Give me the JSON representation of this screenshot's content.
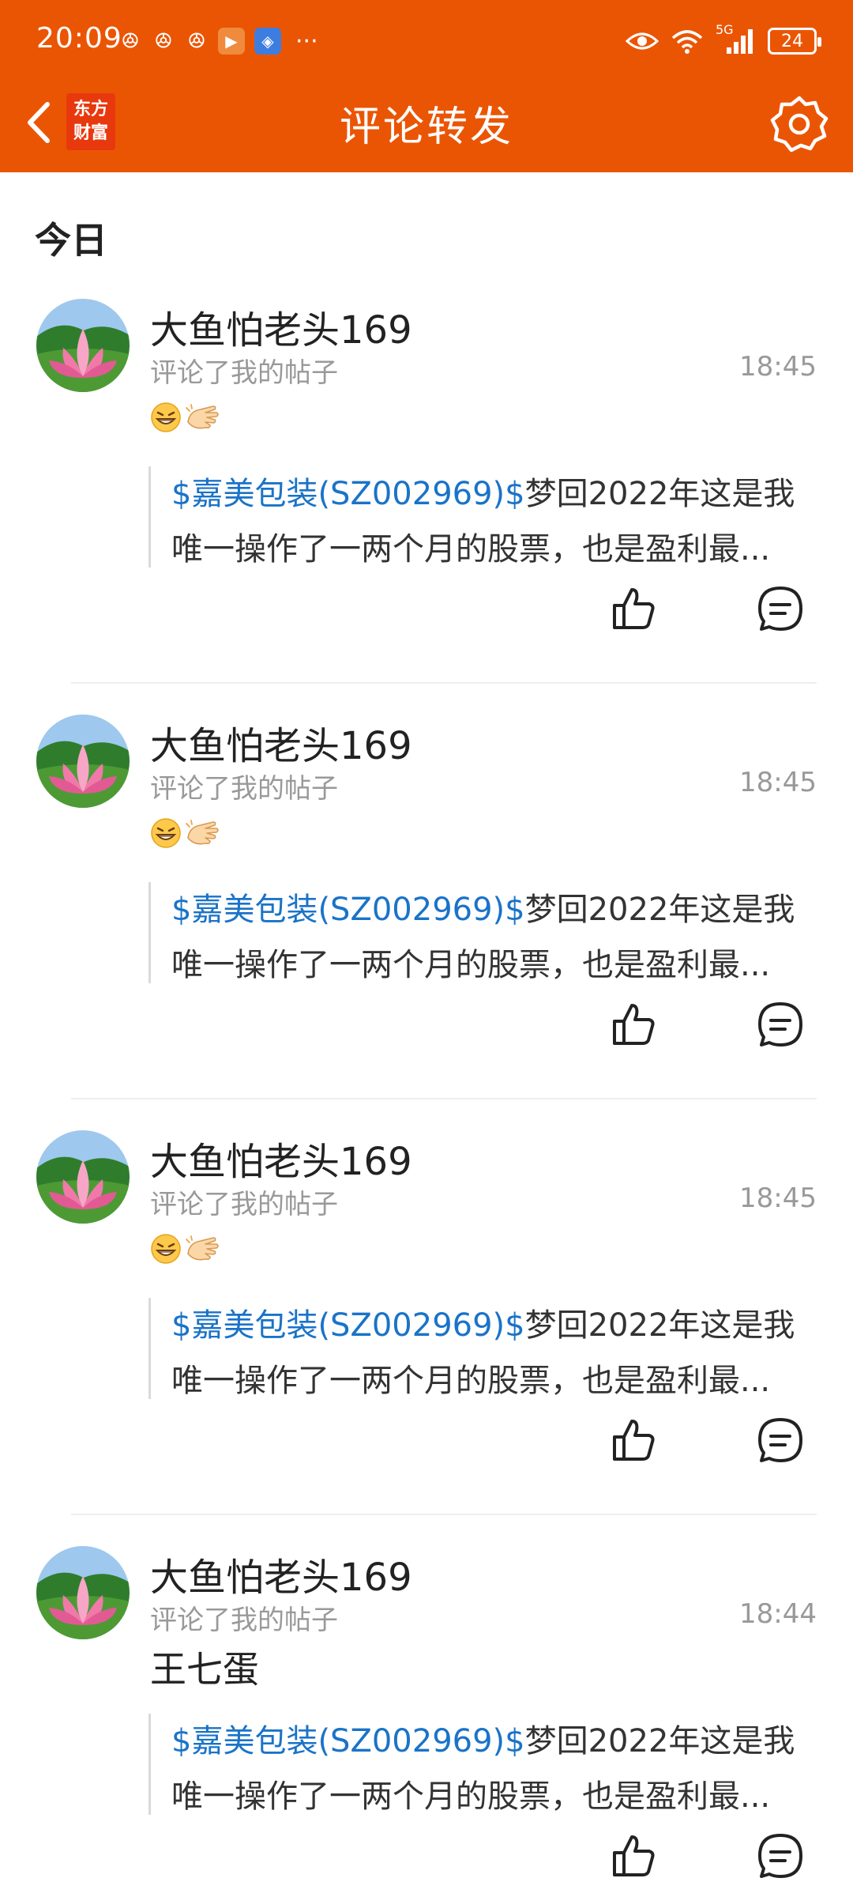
{
  "status_bar": {
    "time": "20:09",
    "network": "5G",
    "battery": "24",
    "more": "···"
  },
  "header": {
    "logo_line1": "东方",
    "logo_line2": "财富",
    "title": "评论转发"
  },
  "section": {
    "title": "今日"
  },
  "colors": {
    "brand": "#ea5504",
    "link": "#1a73c8",
    "muted": "#999999"
  },
  "notifications": [
    {
      "username": "大鱼怕老头169",
      "action": "评论了我的帖子",
      "time": "18:45",
      "emojis": [
        "grinning-face",
        "clapping-hand"
      ],
      "comment": "",
      "quote_stock": "$嘉美包装(SZ002969)$",
      "quote_line1": "梦回2022年这是我",
      "quote_line2": "唯一操作了一两个月的股票，也是盈利最..."
    },
    {
      "username": "大鱼怕老头169",
      "action": "评论了我的帖子",
      "time": "18:45",
      "emojis": [
        "grinning-face",
        "clapping-hand"
      ],
      "comment": "",
      "quote_stock": "$嘉美包装(SZ002969)$",
      "quote_line1": "梦回2022年这是我",
      "quote_line2": "唯一操作了一两个月的股票，也是盈利最..."
    },
    {
      "username": "大鱼怕老头169",
      "action": "评论了我的帖子",
      "time": "18:45",
      "emojis": [
        "grinning-face",
        "clapping-hand"
      ],
      "comment": "",
      "quote_stock": "$嘉美包装(SZ002969)$",
      "quote_line1": "梦回2022年这是我",
      "quote_line2": "唯一操作了一两个月的股票，也是盈利最..."
    },
    {
      "username": "大鱼怕老头169",
      "action": "评论了我的帖子",
      "time": "18:44",
      "emojis": [],
      "comment": "王七蛋",
      "quote_stock": "$嘉美包装(SZ002969)$",
      "quote_line1": "梦回2022年这是我",
      "quote_line2": "唯一操作了一两个月的股票，也是盈利最..."
    }
  ]
}
